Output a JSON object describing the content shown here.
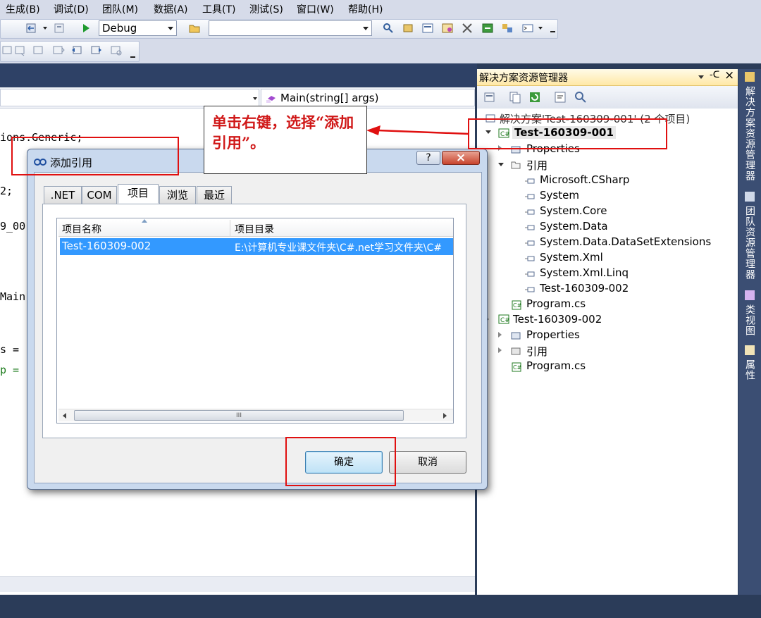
{
  "menu": [
    "生成(B)",
    "调试(D)",
    "团队(M)",
    "数据(A)",
    "工具(T)",
    "测试(S)",
    "窗口(W)",
    "帮助(H)"
  ],
  "toolbar": {
    "config": "Debug",
    "platform": ""
  },
  "editor": {
    "method_nav": "Main(string[] args)",
    "code_lines": [
      "ions.Generic;",
      "2;",
      "9_00",
      "Main",
      "s =",
      " p ="
    ]
  },
  "annotation": {
    "text": "单击右键，选择“添加引用”。"
  },
  "dialog": {
    "title": "添加引用",
    "help": "?",
    "close": "×",
    "tabs": [
      ".NET",
      "COM",
      "项目",
      "浏览",
      "最近"
    ],
    "columns": [
      "项目名称",
      "项目目录"
    ],
    "rows": [
      {
        "name": "Test-160309-002",
        "dir": "E:\\计算机专业课文件夹\\C#.net学习文件夹\\C#"
      }
    ],
    "scroll_thumb": "III",
    "ok": "确定",
    "cancel": "取消"
  },
  "explorer": {
    "title": "解决方案资源管理器",
    "pin": "-ᑕ",
    "close": "×",
    "solution": "解决方案'Test-160309-001' (2 个项目)",
    "project1": "Test-160309-001",
    "properties": "Properties",
    "references": "引用",
    "refs": [
      "Microsoft.CSharp",
      "System",
      "System.Core",
      "System.Data",
      "System.Data.DataSetExtensions",
      "System.Xml",
      "System.Xml.Linq",
      "Test-160309-002"
    ],
    "program": "Program.cs",
    "project2": "Test-160309-002",
    "properties2": "Properties",
    "references2": "引用",
    "program2": "Program.cs"
  },
  "sidetabs": [
    "解决方案资源管理器",
    "团队资源管理器",
    "类视图",
    "属性"
  ]
}
